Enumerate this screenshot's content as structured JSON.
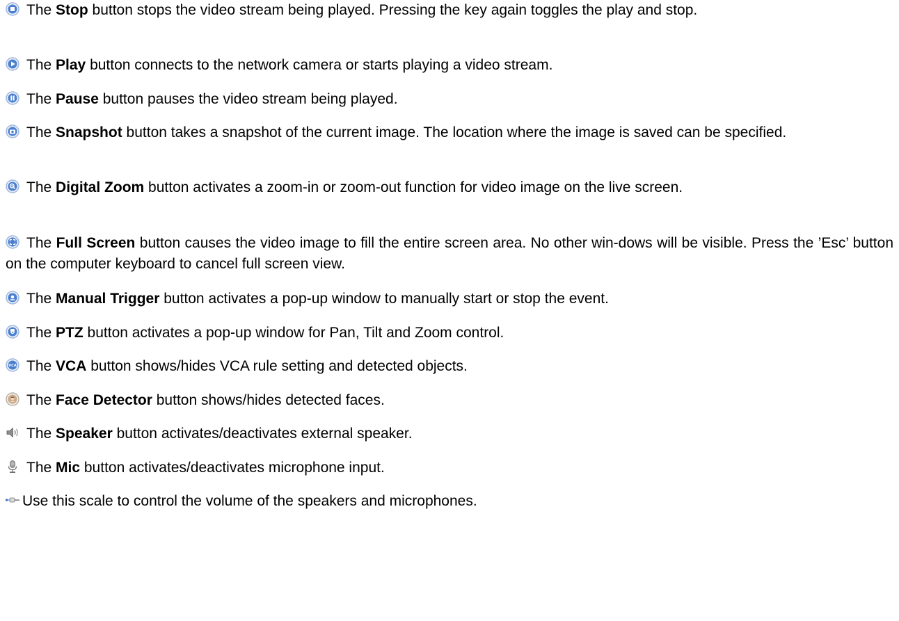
{
  "entries": [
    {
      "icon": "stop-icon",
      "pre": "The ",
      "name": "Stop",
      "post": " button stops the video stream being played. Pressing the key again toggles the play and stop."
    },
    {
      "icon": "play-icon",
      "pre": "The ",
      "name": "Play",
      "post": " button connects to the network camera or starts playing a video stream."
    },
    {
      "icon": "pause-icon",
      "pre": "The ",
      "name": "Pause",
      "post": " button pauses the video stream being played."
    },
    {
      "icon": "snapshot-icon",
      "pre": "The ",
      "name": "Snapshot",
      "post": " button takes a snapshot of the current image. The location where the image is saved can be specified."
    },
    {
      "icon": "digital-zoom-icon",
      "pre": "The ",
      "name": "Digital Zoom",
      "post": " button activates a zoom-in or zoom-out function for video image on the live screen."
    },
    {
      "icon": "full-screen-icon",
      "pre": "The ",
      "name": "Full Screen",
      "post": " button causes the video image to fill the entire screen area. No other win-dows will be visible. Press the ’Esc’ button on the computer keyboard to cancel full screen view."
    },
    {
      "icon": "manual-trigger-icon",
      "pre": "The ",
      "name": "Manual Trigger",
      "post": " button activates a pop-up window to manually start or stop the event."
    },
    {
      "icon": "ptz-icon",
      "pre": "The ",
      "name": "PTZ",
      "post": " button activates a pop-up window for Pan, Tilt and Zoom control."
    },
    {
      "icon": "vca-icon",
      "pre": "The ",
      "name": "VCA",
      "post": " button shows/hides VCA rule setting and detected objects."
    },
    {
      "icon": "face-detector-icon",
      "pre": "The ",
      "name": "Face Detector",
      "post": " button shows/hides detected faces."
    },
    {
      "icon": "speaker-icon",
      "pre": "The ",
      "name": "Speaker",
      "post": " button activates/deactivates external speaker."
    },
    {
      "icon": "mic-icon",
      "pre": "The ",
      "name": "Mic",
      "post": " button activates/deactivates microphone input."
    },
    {
      "icon": "volume-scale-icon",
      "pre": "",
      "name": "",
      "post": "Use this scale to control the volume of the speakers and microphones."
    }
  ],
  "colors": {
    "text": "#000000",
    "icon_blue": "#3b6fc4",
    "icon_ring": "#9fb7de",
    "icon_grey": "#7a7a7a"
  }
}
